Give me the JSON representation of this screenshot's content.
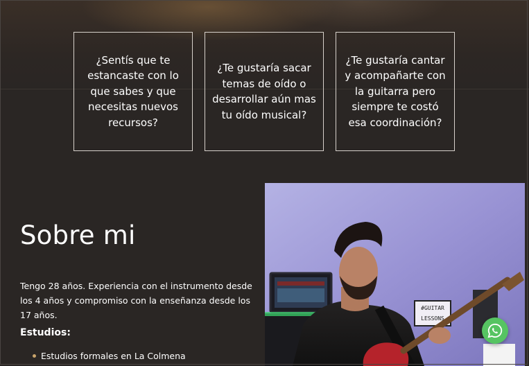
{
  "cards": [
    {
      "text": "¿Sentís que te estancaste con lo que sabes y que necesitas nuevos recursos?"
    },
    {
      "text": "¿Te gustaría sacar temas de oído o desarrollar aún mas tu oído musical?"
    },
    {
      "text": "¿Te gustaría cantar y acompañarte con la guitarra pero siempre te costó esa coordinación?"
    }
  ],
  "about": {
    "title": "Sobre mi",
    "text": "Tengo 28 años. Experiencia con el instrumento desde los 4 años y compromiso con la enseñanza desde los 17 años.",
    "studies_title": "Estudios:",
    "studies": [
      "Estudios formales en La Colmena"
    ]
  },
  "photo": {
    "sign_text": "#GUITAR LESSONS"
  },
  "floating": {
    "icon": "whatsapp-icon"
  },
  "colors": {
    "background": "#2a2624",
    "bullet": "#c9a46b",
    "whatsapp": "#56c462"
  }
}
